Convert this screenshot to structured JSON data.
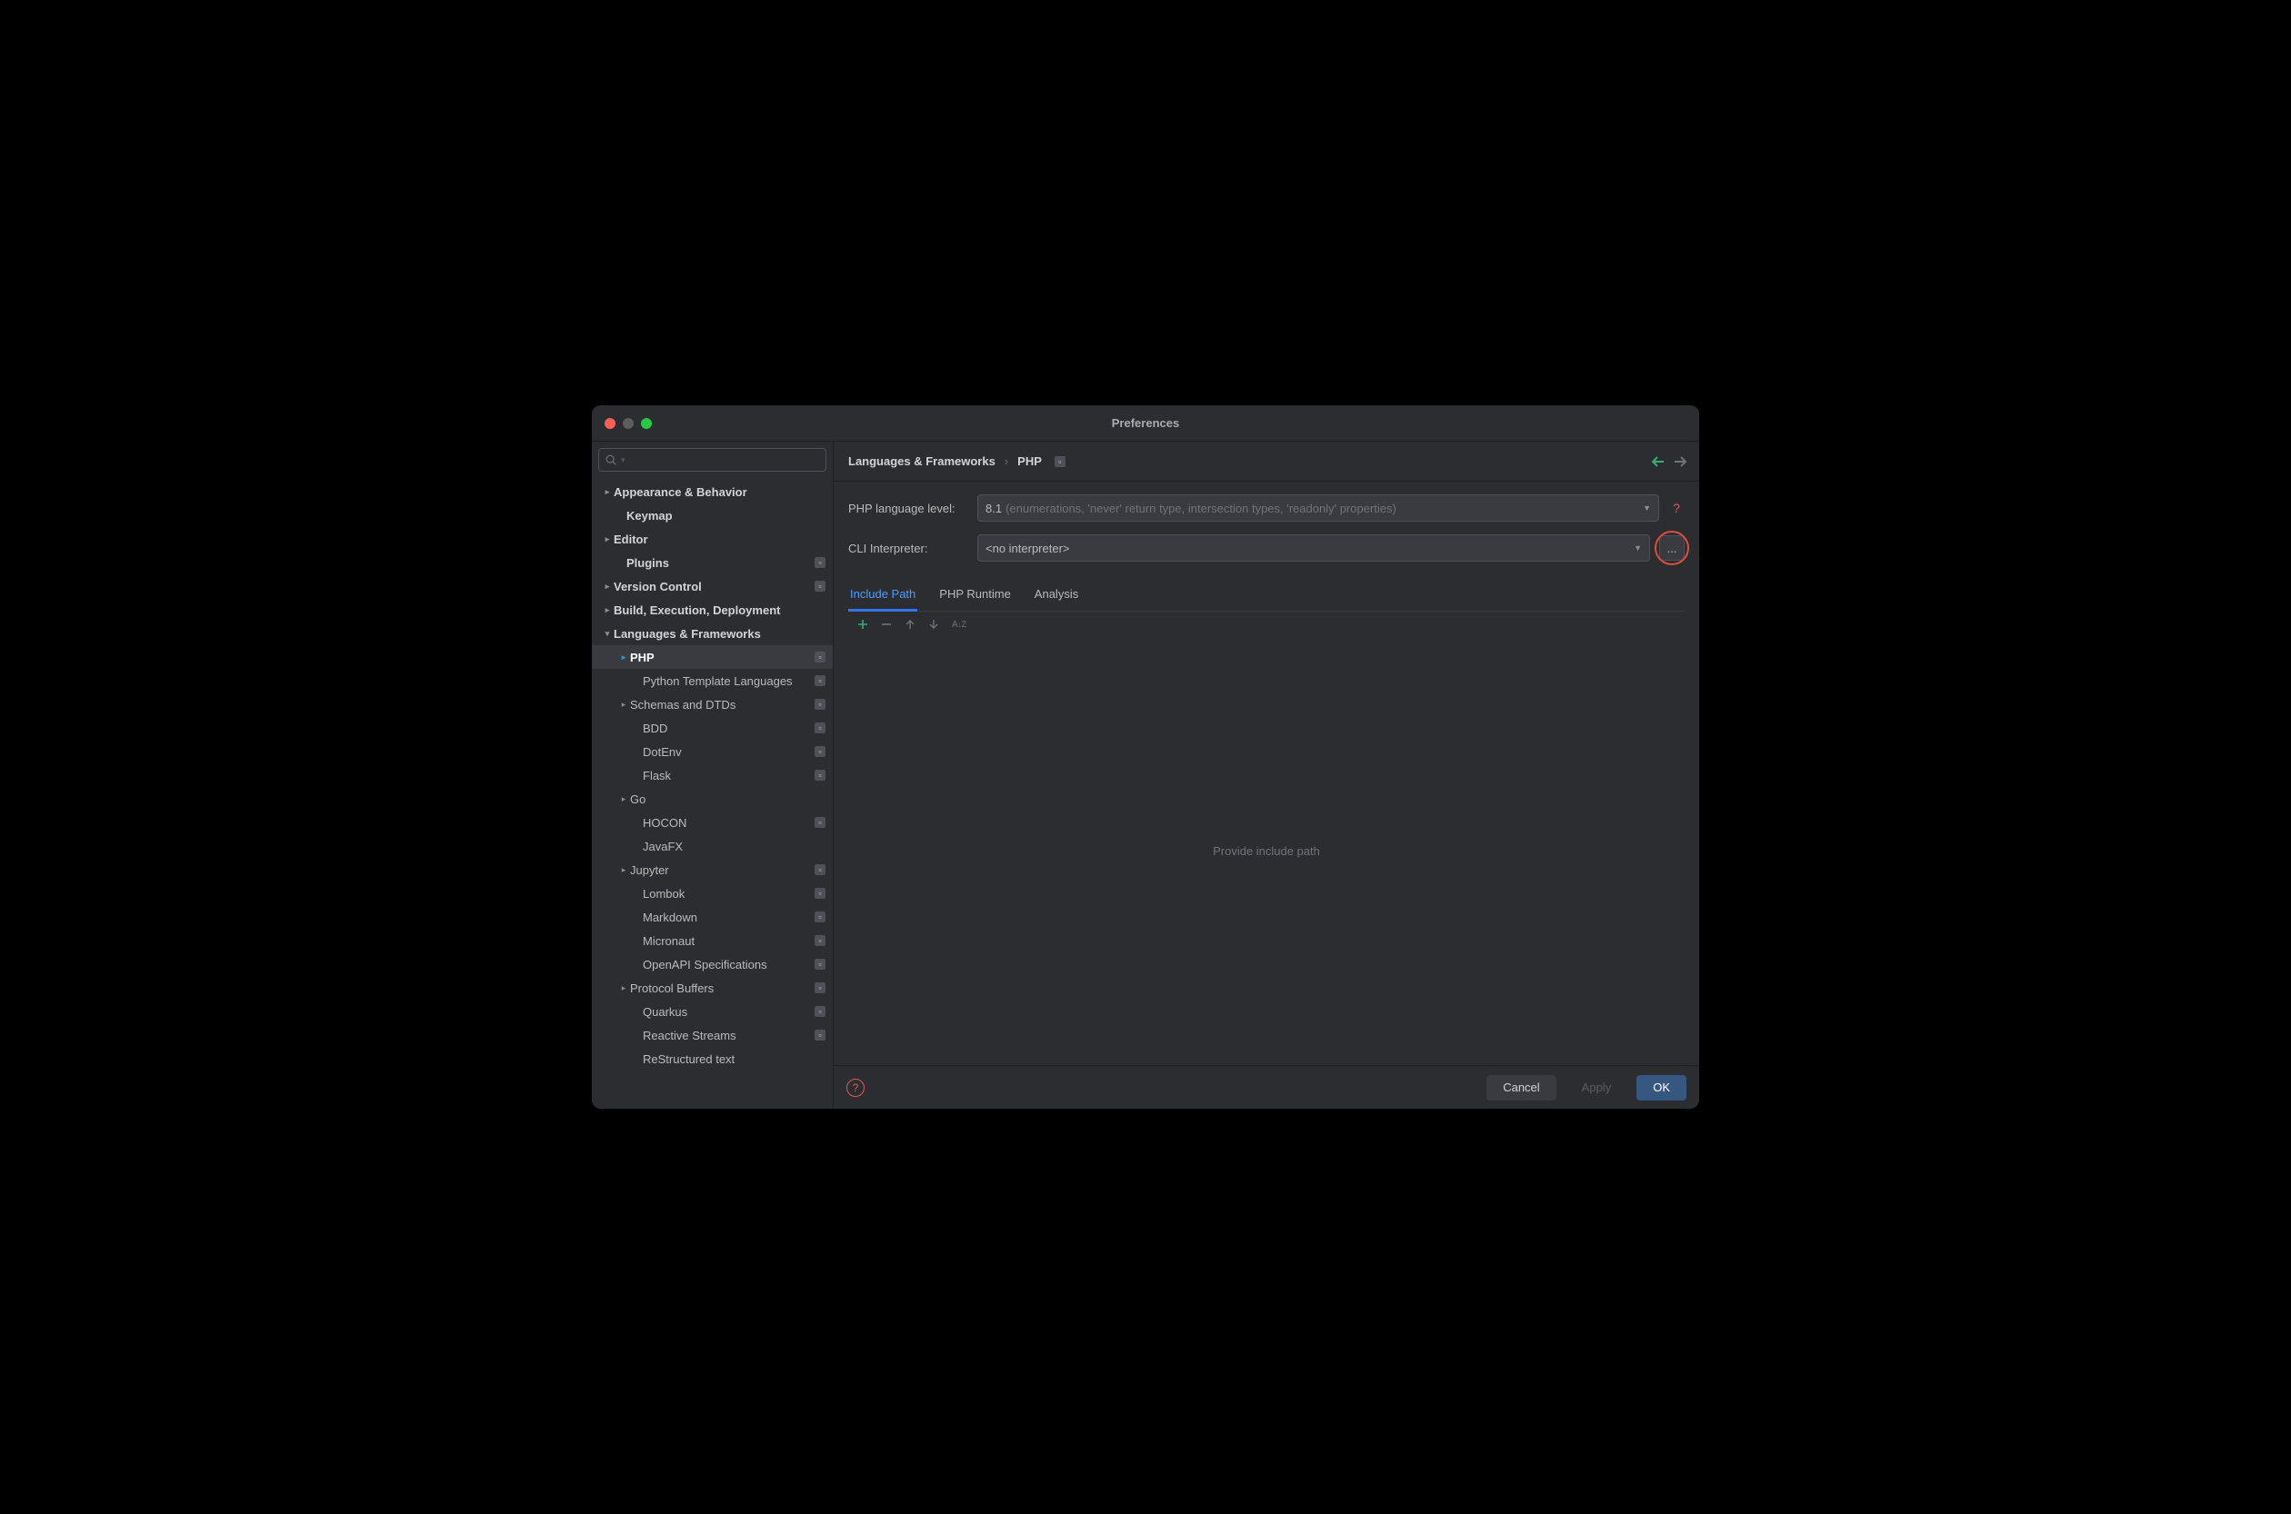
{
  "window": {
    "title": "Preferences"
  },
  "sidebar": {
    "search_placeholder": "",
    "items": [
      {
        "label": "Appearance & Behavior",
        "indent": 10,
        "arrow": "right",
        "bold": true
      },
      {
        "label": "Keymap",
        "indent": 24,
        "arrow": "",
        "bold": true
      },
      {
        "label": "Editor",
        "indent": 10,
        "arrow": "right",
        "bold": true
      },
      {
        "label": "Plugins",
        "indent": 24,
        "arrow": "",
        "bold": true,
        "badge": true
      },
      {
        "label": "Version Control",
        "indent": 10,
        "arrow": "right",
        "bold": true,
        "badge": true
      },
      {
        "label": "Build, Execution, Deployment",
        "indent": 10,
        "arrow": "right",
        "bold": true
      },
      {
        "label": "Languages & Frameworks",
        "indent": 10,
        "arrow": "down",
        "bold": true
      },
      {
        "label": "PHP",
        "indent": 28,
        "arrow": "right",
        "bold": true,
        "badge": true,
        "selected": true,
        "arrow_blue": true
      },
      {
        "label": "Python Template Languages",
        "indent": 42,
        "arrow": "",
        "badge": true
      },
      {
        "label": "Schemas and DTDs",
        "indent": 28,
        "arrow": "right",
        "badge": true
      },
      {
        "label": "BDD",
        "indent": 42,
        "arrow": "",
        "badge": true
      },
      {
        "label": "DotEnv",
        "indent": 42,
        "arrow": "",
        "badge": true
      },
      {
        "label": "Flask",
        "indent": 42,
        "arrow": "",
        "badge": true
      },
      {
        "label": "Go",
        "indent": 28,
        "arrow": "right"
      },
      {
        "label": "HOCON",
        "indent": 42,
        "arrow": "",
        "badge": true
      },
      {
        "label": "JavaFX",
        "indent": 42,
        "arrow": ""
      },
      {
        "label": "Jupyter",
        "indent": 28,
        "arrow": "right",
        "badge": true
      },
      {
        "label": "Lombok",
        "indent": 42,
        "arrow": "",
        "badge": true
      },
      {
        "label": "Markdown",
        "indent": 42,
        "arrow": "",
        "badge": true
      },
      {
        "label": "Micronaut",
        "indent": 42,
        "arrow": "",
        "badge": true
      },
      {
        "label": "OpenAPI Specifications",
        "indent": 42,
        "arrow": "",
        "badge": true
      },
      {
        "label": "Protocol Buffers",
        "indent": 28,
        "arrow": "right",
        "badge": true
      },
      {
        "label": "Quarkus",
        "indent": 42,
        "arrow": "",
        "badge": true
      },
      {
        "label": "Reactive Streams",
        "indent": 42,
        "arrow": "",
        "badge": true
      },
      {
        "label": "ReStructured text",
        "indent": 42,
        "arrow": ""
      }
    ]
  },
  "breadcrumb": {
    "root": "Languages & Frameworks",
    "sep": "›",
    "leaf": "PHP"
  },
  "form": {
    "lang_level_label": "PHP language level:",
    "lang_level_value": "8.1",
    "lang_level_hint": "(enumerations, 'never' return type, intersection types, 'readonly' properties)",
    "cli_label": "CLI Interpreter:",
    "cli_value": "<no interpreter>",
    "ellipsis": "..."
  },
  "tabs": [
    {
      "label": "Include Path",
      "active": true
    },
    {
      "label": "PHP Runtime"
    },
    {
      "label": "Analysis"
    }
  ],
  "toolbar": {
    "plus": "+",
    "minus": "−",
    "up": "↑",
    "down": "↓",
    "sort": "A↓Z"
  },
  "empty_text": "Provide include path",
  "footer": {
    "cancel": "Cancel",
    "apply": "Apply",
    "ok": "OK"
  }
}
